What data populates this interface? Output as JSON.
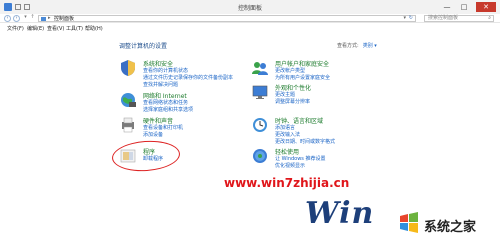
{
  "window": {
    "title": "控制面板",
    "minimize": "—",
    "maximize": "□",
    "close": "✕"
  },
  "address": {
    "path": "控制面板",
    "search_placeholder": "搜索控制面板"
  },
  "menu": [
    "文件(F)",
    "编辑(E)",
    "查看(V)",
    "工具(T)",
    "帮助(H)"
  ],
  "heading": "调整计算机的设置",
  "view_by": {
    "label": "查看方式:",
    "value": "类别 ▾"
  },
  "categories": [
    {
      "title": "系统和安全",
      "links": [
        "查看你的计算机状态",
        "通过文件历史记录保存你的文件备份副本",
        "查找并解决问题"
      ],
      "icon": "shield-icon"
    },
    {
      "title": "网络和 Internet",
      "links": [
        "查看网络状态和任务",
        "选择家庭组和共享选项"
      ],
      "icon": "globe-icon"
    },
    {
      "title": "硬件和声音",
      "links": [
        "查看设备和打印机",
        "添加设备"
      ],
      "icon": "printer-icon"
    },
    {
      "title": "程序",
      "links": [
        "卸载程序"
      ],
      "icon": "programs-icon"
    },
    {
      "title": "用户帐户和家庭安全",
      "links": [
        "更改帐户类型",
        "为所有用户设置家庭安全"
      ],
      "icon": "users-icon"
    },
    {
      "title": "外观和个性化",
      "links": [
        "更改主题",
        "调整屏幕分辨率"
      ],
      "icon": "display-icon"
    },
    {
      "title": "时钟、语言和区域",
      "links": [
        "添加语言",
        "更改输入法",
        "更改日期、时间或数字格式"
      ],
      "icon": "clock-icon"
    },
    {
      "title": "轻松使用",
      "links": [
        "让 Windows 推荐设置",
        "优化视频显示"
      ],
      "icon": "accessibility-icon"
    }
  ],
  "watermark": {
    "url": "www.win7zhijia.cn",
    "logo_text": "Win",
    "brand": "系统之家"
  },
  "colors": {
    "link": "#1a64c6",
    "category_title": "#1a7a2b",
    "watermark_red": "#e0161b",
    "highlight_circle": "#d22222"
  }
}
